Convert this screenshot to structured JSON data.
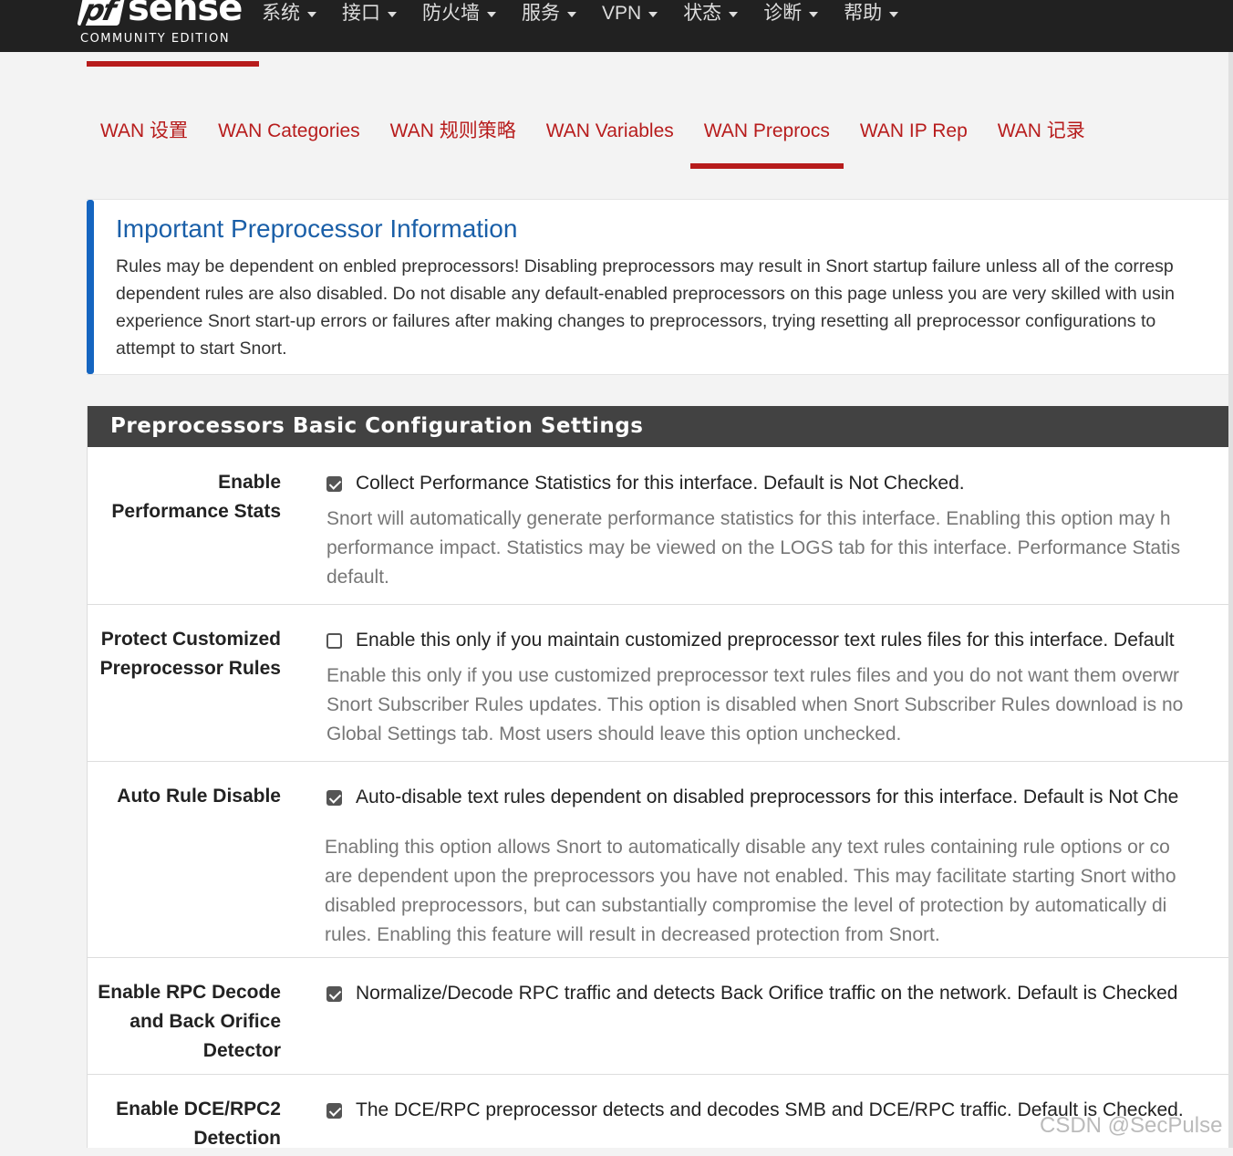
{
  "brand": {
    "logo_mark": "pf",
    "logo_word": "sense",
    "edition": "COMMUNITY EDITION"
  },
  "nav": [
    "系统",
    "接口",
    "防火墙",
    "服务",
    "VPN",
    "状态",
    "诊断",
    "帮助"
  ],
  "tabs": [
    "WAN 设置",
    "WAN Categories",
    "WAN 规则策略",
    "WAN Variables",
    "WAN Preprocs",
    "WAN IP Rep",
    "WAN 记录"
  ],
  "active_tab": "WAN Preprocs",
  "info": {
    "title": "Important Preprocessor Information",
    "lines": [
      "Rules may be dependent on enbled preprocessors! Disabling preprocessors may result in Snort startup failure unless all of the corresp",
      "dependent rules are also disabled. Do not disable any default-enabled preprocessors on this page unless you are very skilled with usin",
      "experience Snort start-up errors or failures after making changes to preprocessors, trying resetting all preprocessor configurations to",
      "attempt to start Snort."
    ]
  },
  "panel": {
    "title": "Preprocessors Basic Configuration Settings",
    "rows": [
      {
        "label": [
          "Enable",
          "Performance Stats"
        ],
        "checked": true,
        "checkbox_label": "Collect Performance Statistics for this interface. Default is Not Checked.",
        "help": [
          "Snort will automatically generate performance statistics for this interface. Enabling this option may h",
          "performance impact. Statistics may be viewed on the LOGS tab for this interface. Performance Statis",
          "default."
        ]
      },
      {
        "label": [
          "Protect Customized",
          "Preprocessor Rules"
        ],
        "checked": false,
        "checkbox_label": "Enable this only if you maintain customized preprocessor text rules files for this interface. Default",
        "help": [
          "Enable this only if you use customized preprocessor text rules files and you do not want them overwr",
          "Snort Subscriber Rules updates. This option is disabled when Snort Subscriber Rules download is no",
          "Global Settings tab. Most users should leave this option unchecked."
        ]
      },
      {
        "label": [
          "Auto Rule Disable"
        ],
        "checked": true,
        "checkbox_label": "Auto-disable text rules dependent on disabled preprocessors for this interface. Default is Not Che",
        "help": [
          "Enabling this option allows Snort to automatically disable any text rules containing rule options or co",
          "are dependent upon the preprocessors you have not enabled. This may facilitate starting Snort witho",
          "disabled preprocessors, but can substantially compromise the level of protection by automatically di",
          "rules. Enabling this feature will result in decreased protection from Snort."
        ]
      },
      {
        "label": [
          "Enable RPC Decode",
          "and Back Orifice",
          "Detector"
        ],
        "checked": true,
        "checkbox_label": "Normalize/Decode RPC traffic and detects Back Orifice traffic on the network. Default is Checked",
        "help": []
      },
      {
        "label": [
          "Enable DCE/RPC2",
          "Detection"
        ],
        "checked": true,
        "checkbox_label": "The DCE/RPC preprocessor detects and decodes SMB and DCE/RPC traffic. Default is Checked.",
        "help": []
      }
    ]
  },
  "watermark": "CSDN @SecPulse",
  "colors": {
    "navbar": "#212121",
    "accent_red": "#b71c1c",
    "info_blue": "#1565c0",
    "panel_header": "#424242"
  }
}
